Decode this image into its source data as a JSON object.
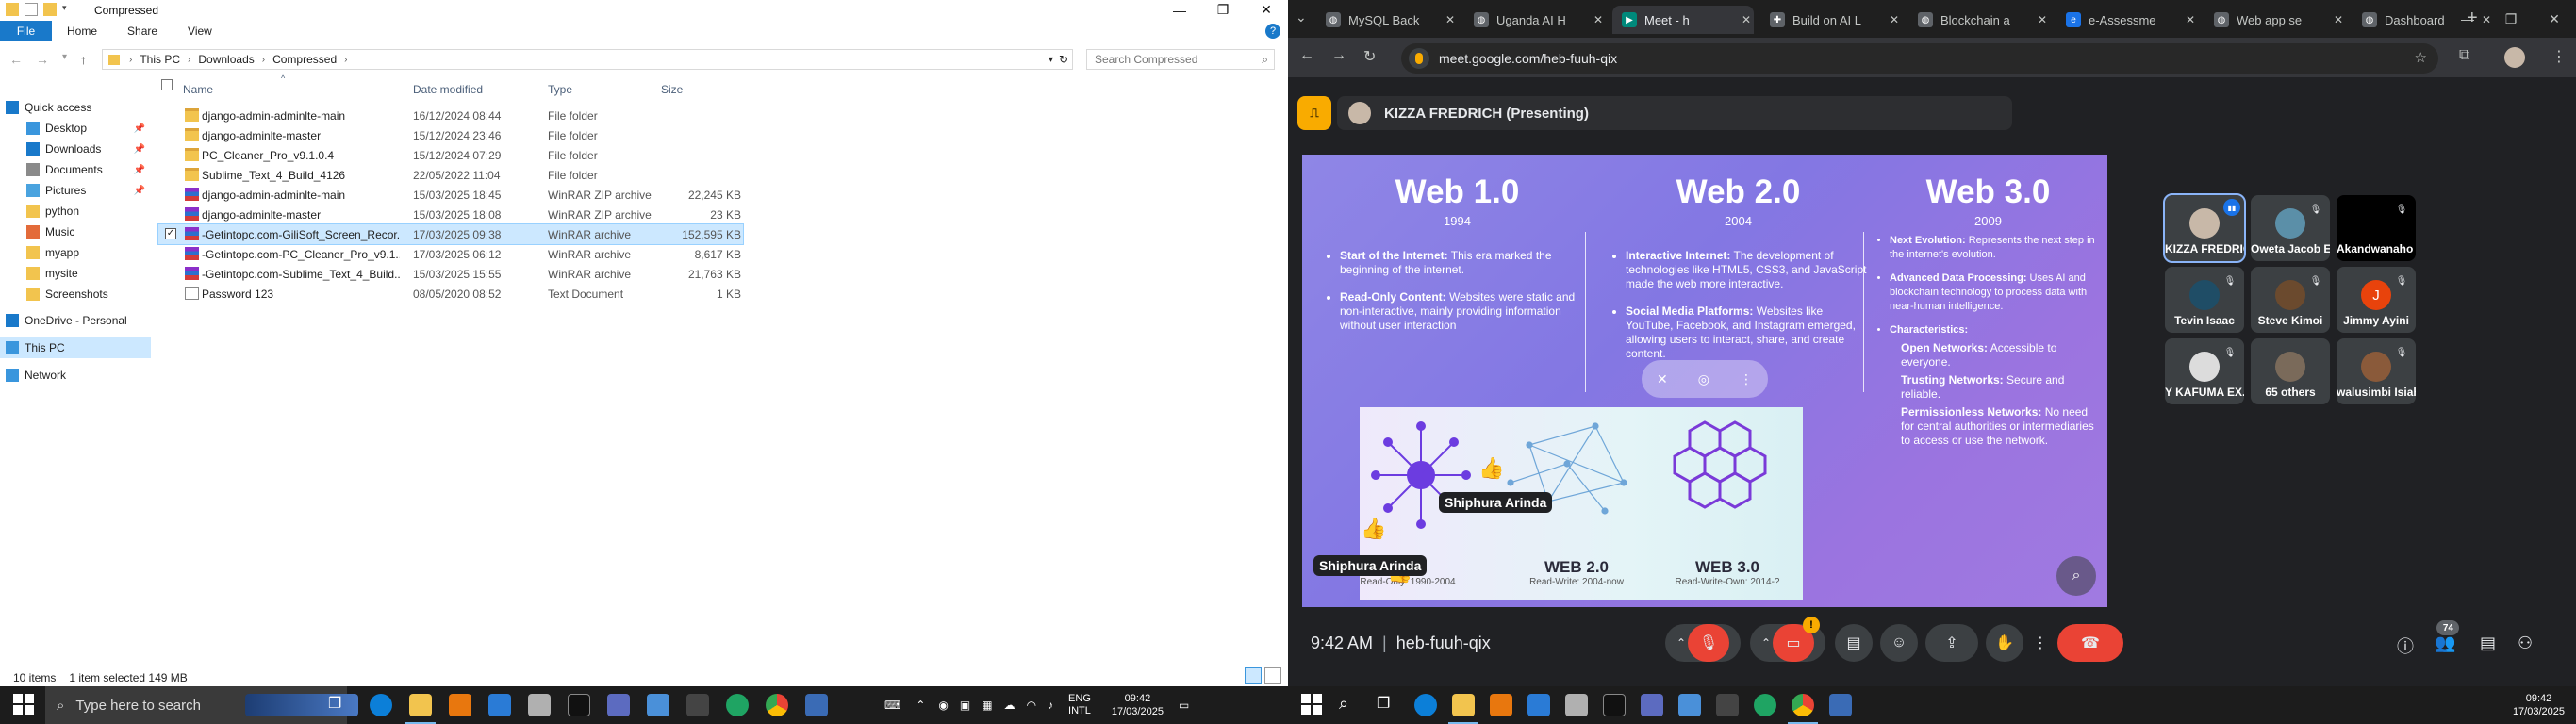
{
  "explorer": {
    "title": "Compressed",
    "ribbon_tabs": [
      "File",
      "Home",
      "Share",
      "View"
    ],
    "breadcrumb": [
      "This PC",
      "Downloads",
      "Compressed"
    ],
    "search_placeholder": "Search Compressed",
    "nav": [
      {
        "label": "Quick access",
        "icon": "star-icon",
        "pinned": false
      },
      {
        "label": "Desktop",
        "icon": "desktop-icon",
        "pinned": true
      },
      {
        "label": "Downloads",
        "icon": "download-icon",
        "pinned": true
      },
      {
        "label": "Documents",
        "icon": "documents-icon",
        "pinned": true
      },
      {
        "label": "Pictures",
        "icon": "pictures-icon",
        "pinned": true
      },
      {
        "label": "python",
        "icon": "folder-icon",
        "pinned": false
      },
      {
        "label": "Music",
        "icon": "music-icon",
        "pinned": false
      },
      {
        "label": "myapp",
        "icon": "folder-icon",
        "pinned": false
      },
      {
        "label": "mysite",
        "icon": "folder-icon",
        "pinned": false
      },
      {
        "label": "Screenshots",
        "icon": "folder-icon",
        "pinned": false
      },
      {
        "label": "OneDrive - Personal",
        "icon": "cloud-icon",
        "pinned": false
      },
      {
        "label": "This PC",
        "icon": "pc-icon",
        "pinned": false
      },
      {
        "label": "Network",
        "icon": "network-icon",
        "pinned": false
      }
    ],
    "columns": [
      "Name",
      "Date modified",
      "Type",
      "Size"
    ],
    "files": [
      {
        "name": "django-admin-adminlte-main",
        "date": "16/12/2024 08:44",
        "type": "File folder",
        "size": "",
        "kind": "folder"
      },
      {
        "name": "django-adminlte-master",
        "date": "15/12/2024 23:46",
        "type": "File folder",
        "size": "",
        "kind": "folder"
      },
      {
        "name": "PC_Cleaner_Pro_v9.1.0.4",
        "date": "15/12/2024 07:29",
        "type": "File folder",
        "size": "",
        "kind": "folder"
      },
      {
        "name": "Sublime_Text_4_Build_4126",
        "date": "22/05/2022 11:04",
        "type": "File folder",
        "size": "",
        "kind": "folder"
      },
      {
        "name": "django-admin-adminlte-main",
        "date": "15/03/2025 18:45",
        "type": "WinRAR ZIP archive",
        "size": "22,245 KB",
        "kind": "rar"
      },
      {
        "name": "django-adminlte-master",
        "date": "15/03/2025 18:08",
        "type": "WinRAR ZIP archive",
        "size": "23 KB",
        "kind": "rar"
      },
      {
        "name": "-Getintopc.com-GiliSoft_Screen_Recor...",
        "date": "17/03/2025 09:38",
        "type": "WinRAR archive",
        "size": "152,595 KB",
        "kind": "rar"
      },
      {
        "name": "-Getintopc.com-PC_Cleaner_Pro_v9.1....",
        "date": "17/03/2025 06:12",
        "type": "WinRAR archive",
        "size": "8,617 KB",
        "kind": "rar"
      },
      {
        "name": "-Getintopc.com-Sublime_Text_4_Build...",
        "date": "15/03/2025 15:55",
        "type": "WinRAR archive",
        "size": "21,763 KB",
        "kind": "rar"
      },
      {
        "name": "Password 123",
        "date": "08/05/2020 08:52",
        "type": "Text Document",
        "size": "1 KB",
        "kind": "txt"
      }
    ],
    "selected_index": 6,
    "status_items": "10 items",
    "status_selected": "1 item selected  149 MB"
  },
  "chrome": {
    "tabs": [
      {
        "title": "MySQL Back",
        "color": "#5f6368",
        "glyph": "◍"
      },
      {
        "title": "Uganda AI H",
        "color": "#5f6368",
        "glyph": "◍"
      },
      {
        "title": "Meet - h",
        "color": "#00897b",
        "glyph": "▶",
        "active": true
      },
      {
        "title": "Build on AI L",
        "color": "#5f6368",
        "glyph": "✚"
      },
      {
        "title": "Blockchain a",
        "color": "#5f6368",
        "glyph": "◍"
      },
      {
        "title": "e-Assessme",
        "color": "#1a73e8",
        "glyph": "e"
      },
      {
        "title": "Web app se",
        "color": "#5f6368",
        "glyph": "◍"
      },
      {
        "title": "Dashboard",
        "color": "#5f6368",
        "glyph": "◍"
      }
    ],
    "url": "meet.google.com/heb-fuuh-qix"
  },
  "meet": {
    "presenter_label": "KIZZA FREDRICH (Presenting)",
    "slide": {
      "columns": [
        {
          "title": "Web 1.0",
          "year": "1994",
          "points": [
            {
              "head": "Start of the Internet:",
              "body": " This era marked the beginning of the internet."
            },
            {
              "head": "Read-Only Content:",
              "body": " Websites were static and non-interactive, mainly providing information without user interaction"
            }
          ]
        },
        {
          "title": "Web 2.0",
          "year": "2004",
          "points": [
            {
              "head": "Interactive Internet:",
              "body": " The development of technologies like HTML5, CSS3, and JavaScript made the web more interactive."
            },
            {
              "head": "Social Media Platforms:",
              "body": " Websites like YouTube, Facebook, and Instagram emerged, allowing users to interact, share, and create content."
            }
          ]
        },
        {
          "title": "Web 3.0",
          "year": "2009",
          "points": [
            {
              "head": "Next Evolution:",
              "body": " Represents the next step in the internet's evolution."
            },
            {
              "head": "Advanced Data Processing:",
              "body": " Uses AI and blockchain technology to process data with near-human intelligence."
            },
            {
              "head": "Characteristics:",
              "body": ""
            }
          ],
          "sub": [
            {
              "head": "Open Networks:",
              "body": " Accessible to everyone."
            },
            {
              "head": "Trusting Networks:",
              "body": " Secure and reliable."
            },
            {
              "head": "Permissionless Networks:",
              "body": " No need for central authorities or intermediaries to access or use the network."
            }
          ]
        }
      ],
      "images": [
        {
          "title": "1.0",
          "sub": "Read-Only: 1990-2004"
        },
        {
          "title": "WEB 2.0",
          "sub": "Read-Write: 2004-now"
        },
        {
          "title": "WEB 3.0",
          "sub": "Read-Write-Own: 2014-?"
        }
      ],
      "reaction_name": "Shiphura Arinda"
    },
    "participants": [
      {
        "name": "KIZZA FREDRICH",
        "color": "#c8b8a8",
        "initial": "",
        "speaking": true
      },
      {
        "name": "Oweta Jacob E...",
        "color": "#5b8fa8",
        "initial": "",
        "speaking": false
      },
      {
        "name": "Akandwanaho I...",
        "color": "#000",
        "initial": "",
        "speaking": false
      },
      {
        "name": "Tevin Isaac",
        "color": "#1f4d66",
        "initial": "",
        "speaking": false
      },
      {
        "name": "Steve Kimoi",
        "color": "#6b4a2e",
        "initial": "",
        "speaking": false
      },
      {
        "name": "Jimmy Ayini",
        "color": "#e8430c",
        "initial": "J",
        "speaking": false
      },
      {
        "name": "Y KAFUMA EX...",
        "color": "#dcdcdc",
        "initial": "",
        "speaking": false
      },
      {
        "name": "65 others",
        "color": "#7a6a5a",
        "initial": "",
        "speaking": false
      },
      {
        "name": "walusimbi Isiah",
        "color": "#8a5a3a",
        "initial": "",
        "speaking": false
      }
    ],
    "time": "9:42 AM",
    "meeting_code": "heb-fuuh-qix",
    "people_count": "74",
    "reaction_badge": "!"
  },
  "taskbar": {
    "search_placeholder": "Type here to search",
    "lang_top": "ENG",
    "lang_bottom": "INTL",
    "time": "09:42",
    "date": "17/03/2025"
  }
}
